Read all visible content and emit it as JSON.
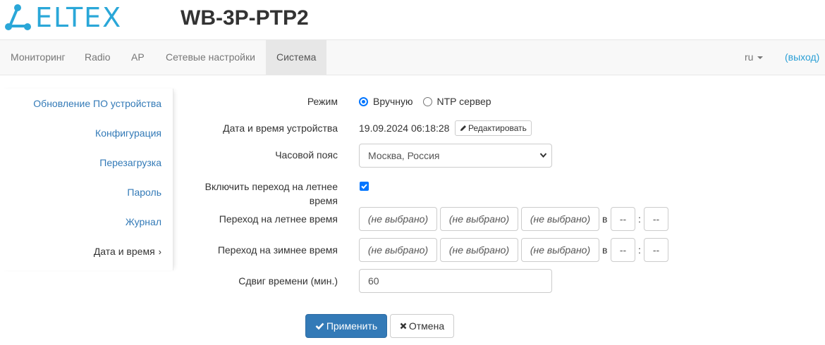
{
  "header": {
    "logo_text": "ELTEX",
    "device_title": "WB-3P-PTP2"
  },
  "nav": {
    "items": [
      {
        "label": "Мониторинг"
      },
      {
        "label": "Radio"
      },
      {
        "label": "AP"
      },
      {
        "label": "Сетевые настройки"
      },
      {
        "label": "Система",
        "active": true
      }
    ],
    "lang": "ru",
    "logout": "(выход)"
  },
  "sidebar": {
    "items": [
      {
        "label": "Обновление ПО устройства"
      },
      {
        "label": "Конфигурация"
      },
      {
        "label": "Перезагрузка"
      },
      {
        "label": "Пароль"
      },
      {
        "label": "Журнал"
      },
      {
        "label": "Дата и время",
        "active": true
      }
    ],
    "active_chevron": "›"
  },
  "form": {
    "mode": {
      "label": "Режим",
      "options": [
        "Вручную",
        "NTP сервер"
      ],
      "selected": "Вручную"
    },
    "datetime": {
      "label": "Дата и время устройства",
      "value": "19.09.2024 06:18:28",
      "edit_button": "Редактировать"
    },
    "timezone": {
      "label": "Часовой пояс",
      "value": "Москва, Россия"
    },
    "dst_enable": {
      "label_line1": "Включить переход на летнее",
      "label_line2": "время",
      "checked": true
    },
    "dst_start": {
      "label": "Переход на летнее время",
      "fields": [
        "(не выбрано)",
        "(не выбрано)",
        "(не выбрано)"
      ],
      "at_label": "в",
      "hour": "--",
      "colon": ":",
      "minute": "--"
    },
    "dst_end": {
      "label": "Переход на зимнее время",
      "fields": [
        "(не выбрано)",
        "(не выбрано)",
        "(не выбрано)"
      ],
      "at_label": "в",
      "hour": "--",
      "colon": ":",
      "minute": "--"
    },
    "shift": {
      "label": "Сдвиг времени (мин.)",
      "value": "60"
    },
    "apply_button": "Применить",
    "cancel_button": "Отмена"
  },
  "colors": {
    "brand": "#2aa7d8",
    "link": "#337ab7",
    "primary": "#337ab7",
    "nav_bg": "#f8f8f8",
    "nav_active_bg": "#e7e7e7",
    "checkbox": "#0075ff"
  },
  "icons": [
    "eltex-logo-icon",
    "pencil-icon",
    "select-arrow-icon",
    "checkmark-icon",
    "close-icon",
    "caret-down-icon"
  ]
}
